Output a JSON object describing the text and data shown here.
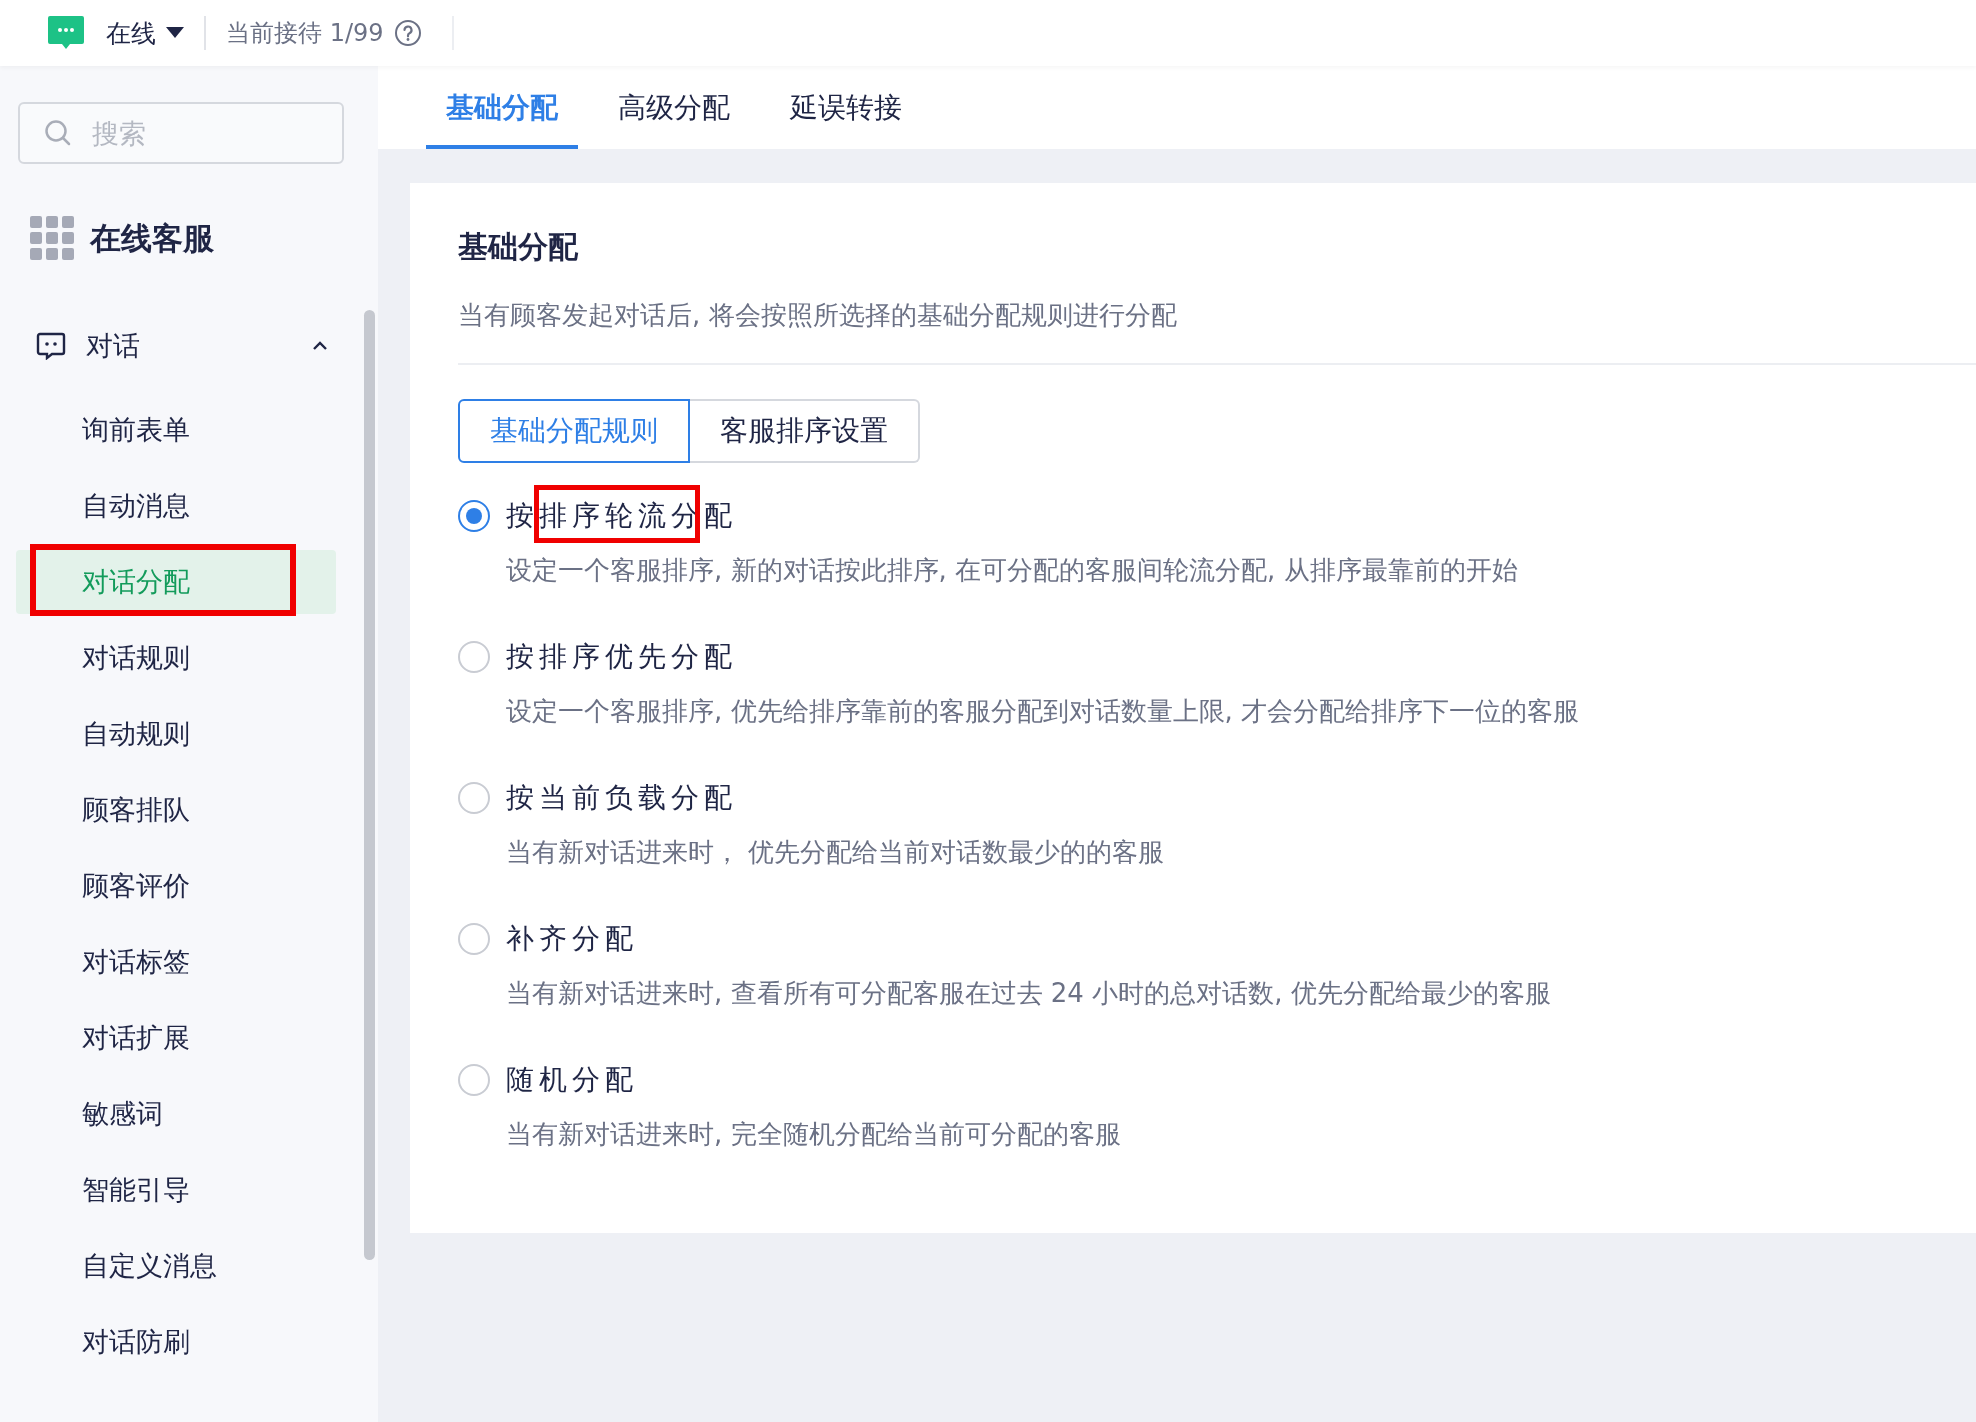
{
  "top_bar": {
    "status": "在线",
    "reception": "当前接待 1/99"
  },
  "sidebar": {
    "search": {
      "placeholder": "搜索"
    },
    "app_title": "在线客服",
    "group": {
      "label": "对话",
      "expanded": true,
      "items": [
        {
          "label": "询前表单",
          "selected": false,
          "highlighted": false
        },
        {
          "label": "自动消息",
          "selected": false,
          "highlighted": false
        },
        {
          "label": "对话分配",
          "selected": true,
          "highlighted": true
        },
        {
          "label": "对话规则",
          "selected": false,
          "highlighted": false
        },
        {
          "label": "自动规则",
          "selected": false,
          "highlighted": false
        },
        {
          "label": "顾客排队",
          "selected": false,
          "highlighted": false
        },
        {
          "label": "顾客评价",
          "selected": false,
          "highlighted": false
        },
        {
          "label": "对话标签",
          "selected": false,
          "highlighted": false
        },
        {
          "label": "对话扩展",
          "selected": false,
          "highlighted": false
        },
        {
          "label": "敏感词",
          "selected": false,
          "highlighted": false
        },
        {
          "label": "智能引导",
          "selected": false,
          "highlighted": false
        },
        {
          "label": "自定义消息",
          "selected": false,
          "highlighted": false
        },
        {
          "label": "对话防刷",
          "selected": false,
          "highlighted": false
        }
      ]
    }
  },
  "tabs": [
    {
      "label": "基础分配",
      "selected": true
    },
    {
      "label": "高级分配",
      "selected": false
    },
    {
      "label": "延误转接",
      "selected": false
    }
  ],
  "card": {
    "title": "基础分配",
    "description": "当有顾客发起对话后, 将会按照所选择的基础分配规则进行分配",
    "segments": [
      {
        "label": "基础分配规则",
        "selected": true
      },
      {
        "label": "客服排序设置",
        "selected": false
      }
    ],
    "options": [
      {
        "label": "按排序轮流分配",
        "description": "设定一个客服排序, 新的对话按此排序, 在可分配的客服间轮流分配, 从排序最靠前的开始",
        "selected": true,
        "highlighted": true
      },
      {
        "label": "按排序优先分配",
        "description": "设定一个客服排序, 优先给排序靠前的客服分配到对话数量上限, 才会分配给排序下一位的客服",
        "selected": false,
        "highlighted": false
      },
      {
        "label": "按当前负载分配",
        "description": "当有新对话进来时， 优先分配给当前对话数最少的的客服",
        "selected": false,
        "highlighted": false
      },
      {
        "label": "补齐分配",
        "description": "当有新对话进来时, 查看所有可分配客服在过去 24 小时的总对话数, 优先分配给最少的客服",
        "selected": false,
        "highlighted": false
      },
      {
        "label": "随机分配",
        "description": "当有新对话进来时, 完全随机分配给当前可分配的客服",
        "selected": false,
        "highlighted": false
      }
    ]
  }
}
